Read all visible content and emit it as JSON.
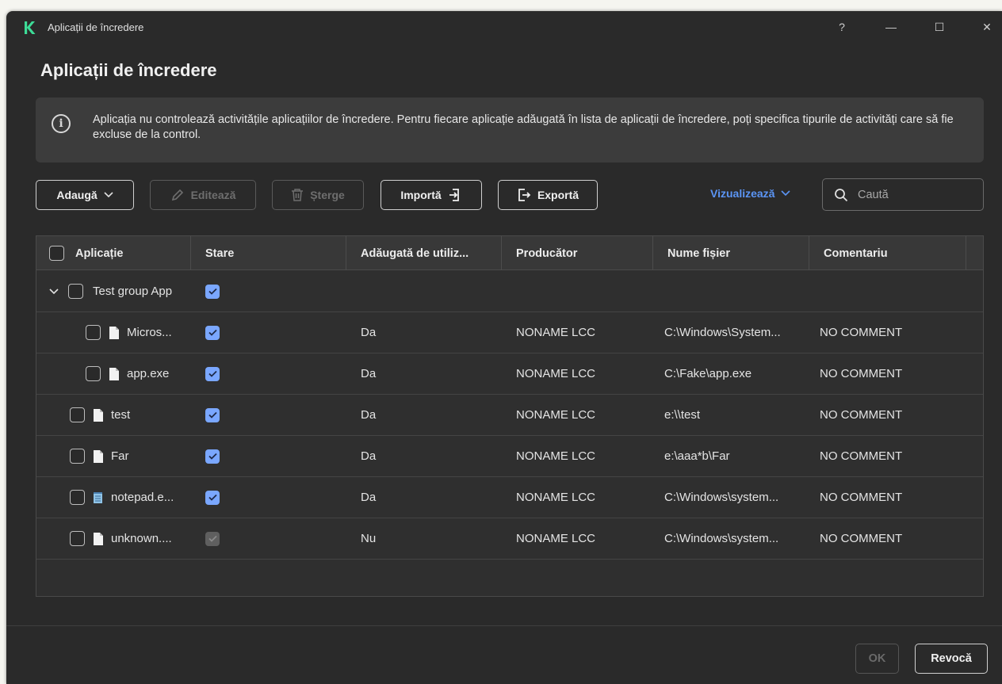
{
  "window": {
    "title": "Aplicații de încredere",
    "help_glyph": "?",
    "minimize_glyph": "—",
    "maximize_glyph": "☐",
    "close_glyph": "✕"
  },
  "page_title": "Aplicații de încredere",
  "info": {
    "text": "Aplicația nu controlează activitățile aplicațiilor de încredere. Pentru fiecare aplicație adăugată în lista de aplicații de încredere, poți specifica tipurile de activități care să fie excluse de la control.",
    "icon": "info-icon"
  },
  "toolbar": {
    "add_label": "Adaugă",
    "edit_label": "Editează",
    "delete_label": "Șterge",
    "import_label": "Importă",
    "export_label": "Exportă",
    "view_label": "Vizualizează",
    "search_placeholder": "Caută"
  },
  "table": {
    "columns": [
      "Aplicație",
      "Stare",
      "Adăugată de utiliz...",
      "Producător",
      "Nume fișier",
      "Comentariu"
    ],
    "group": {
      "name": "Test group App",
      "enabled": true,
      "expanded": true
    },
    "rows": [
      {
        "name": "Micros...",
        "icon": "file-icon",
        "nested": true,
        "enabled": true,
        "added_by_user": "Da",
        "vendor": "NONAME LCC",
        "file": "C:\\Windows\\System...",
        "comment": "NO COMMENT"
      },
      {
        "name": "app.exe",
        "icon": "file-icon",
        "nested": true,
        "enabled": true,
        "added_by_user": "Da",
        "vendor": "NONAME LCC",
        "file": "C:\\Fake\\app.exe",
        "comment": "NO COMMENT"
      },
      {
        "name": "test",
        "icon": "file-icon",
        "nested": false,
        "enabled": true,
        "added_by_user": "Da",
        "vendor": "NONAME LCC",
        "file": "e:\\\\test",
        "comment": "NO COMMENT"
      },
      {
        "name": "Far",
        "icon": "file-icon",
        "nested": false,
        "enabled": true,
        "added_by_user": "Da",
        "vendor": "NONAME LCC",
        "file": "e:\\aaa*b\\Far",
        "comment": "NO COMMENT"
      },
      {
        "name": "notepad.e...",
        "icon": "notepad-icon",
        "nested": false,
        "enabled": true,
        "added_by_user": "Da",
        "vendor": "NONAME LCC",
        "file": "C:\\Windows\\system...",
        "comment": "NO COMMENT"
      },
      {
        "name": "unknown....",
        "icon": "file-icon",
        "nested": false,
        "enabled": true,
        "disabled_look": true,
        "added_by_user": "Nu",
        "vendor": "NONAME LCC",
        "file": "C:\\Windows\\system...",
        "comment": "NO COMMENT"
      }
    ]
  },
  "footer": {
    "ok_label": "OK",
    "cancel_label": "Revocă"
  },
  "colors": {
    "accent": "#5b95f5",
    "checkbox_on": "#7aa7ff",
    "background": "#2a2a2a"
  }
}
